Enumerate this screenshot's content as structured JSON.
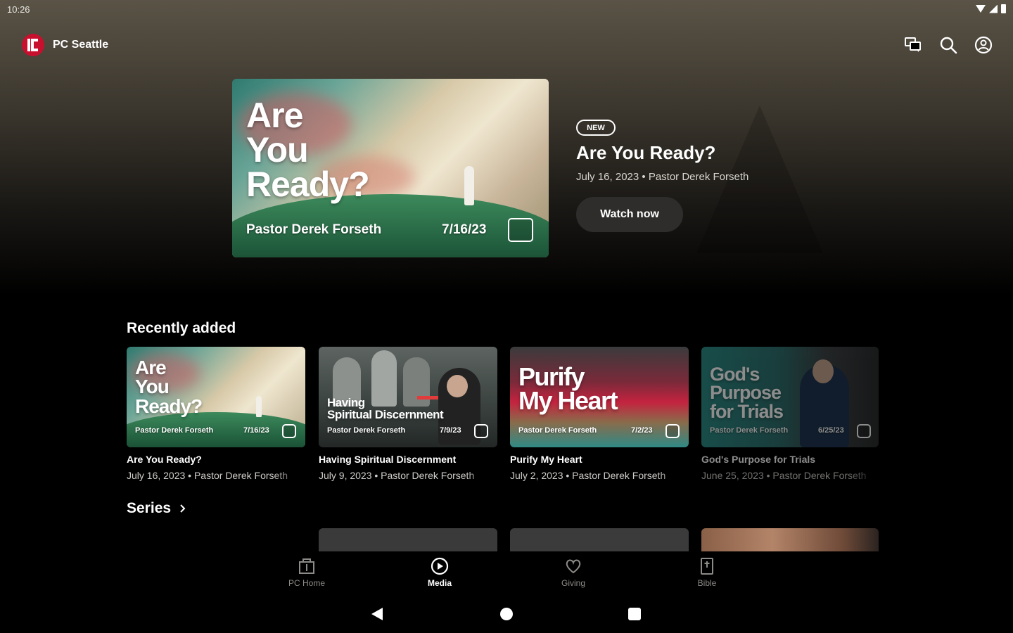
{
  "status_bar": {
    "time": "10:26"
  },
  "app": {
    "name": "PC Seattle"
  },
  "top_actions": [
    "chat-icon",
    "search-icon",
    "account-icon"
  ],
  "featured": {
    "badge": "NEW",
    "title": "Are You Ready?",
    "meta": "July 16, 2023 • Pastor Derek Forseth",
    "watch_label": "Watch now",
    "art": {
      "title_line1": "Are",
      "title_line2": "You",
      "title_line3": "Ready?",
      "speaker": "Pastor Derek Forseth",
      "date": "7/16/23"
    }
  },
  "recently_added": {
    "title": "Recently added",
    "items": [
      {
        "title": "Are You Ready?",
        "meta": "July 16, 2023 • Pastor Derek Forseth",
        "art_title": [
          "Are",
          "You",
          "Ready?"
        ],
        "art_speaker": "Pastor Derek Forseth",
        "art_date": "7/16/23"
      },
      {
        "title": "Having Spiritual Discernment",
        "meta": "July 9, 2023 • Pastor Derek Forseth",
        "art_title": [
          "Having",
          "Spiritual Discernment"
        ],
        "art_speaker": "Pastor Derek Forseth",
        "art_date": "7/9/23"
      },
      {
        "title": "Purify My Heart",
        "meta": "July 2, 2023 • Pastor Derek Forseth",
        "art_title": [
          "Purify",
          "My Heart"
        ],
        "art_speaker": "Pastor Derek Forseth",
        "art_date": "7/2/23"
      },
      {
        "title": "God's Purpose for Trials",
        "meta": "June 25, 2023 • Pastor Derek Forseth",
        "art_title": [
          "God's",
          "Purpose",
          "for Trials"
        ],
        "art_speaker": "Pastor Derek Forseth",
        "art_date": "6/25/23"
      }
    ]
  },
  "series": {
    "title": "Series"
  },
  "bottom_nav": {
    "items": [
      {
        "label": "PC Home",
        "icon": "home-icon"
      },
      {
        "label": "Media",
        "icon": "play-icon",
        "active": true
      },
      {
        "label": "Giving",
        "icon": "heart-icon"
      },
      {
        "label": "Bible",
        "icon": "bible-icon"
      }
    ]
  },
  "colors": {
    "background": "#000000",
    "button": "#2e2d2b",
    "muted_text": "#8d8b87",
    "brand_red": "#c8102e"
  }
}
